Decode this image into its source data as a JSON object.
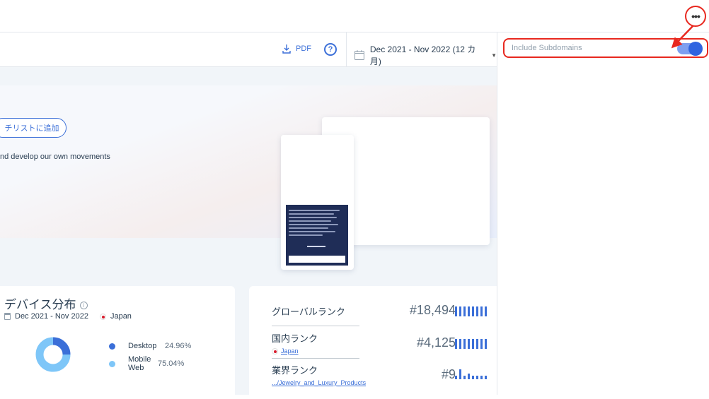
{
  "topbar": {
    "more_label": "•••"
  },
  "toolbar": {
    "pdf_label": "PDF",
    "help_label": "?",
    "date_range": "Dec 2021 - Nov 2022 (12 カ月)"
  },
  "side_panel": {
    "subdomains_label": "Include Subdomains",
    "subdomains_enabled": true
  },
  "hero": {
    "add_list_label": "チリストに追加",
    "description": "nd develop our own movements"
  },
  "device_card": {
    "title": "デバイス分布",
    "date": "Dec 2021 - Nov 2022",
    "country": "Japan",
    "legend": [
      {
        "name": "Desktop",
        "pct": "24.96%",
        "color": "#3b6fd8",
        "value": 24.96
      },
      {
        "name": "Mobile Web",
        "pct": "75.04%",
        "color": "#7ec6f8",
        "value": 75.04
      }
    ]
  },
  "rank_card": {
    "global": {
      "label": "グローバルランク",
      "value": "#18,494"
    },
    "country": {
      "label": "国内ランク",
      "sub": "Japan",
      "value": "#4,125"
    },
    "category": {
      "label": "業界ランク",
      "sub": ".../Jewelry_and_Luxury_Products",
      "value": "#9"
    }
  },
  "colors": {
    "accent": "#3b6fd8",
    "highlight": "#e8281f"
  }
}
